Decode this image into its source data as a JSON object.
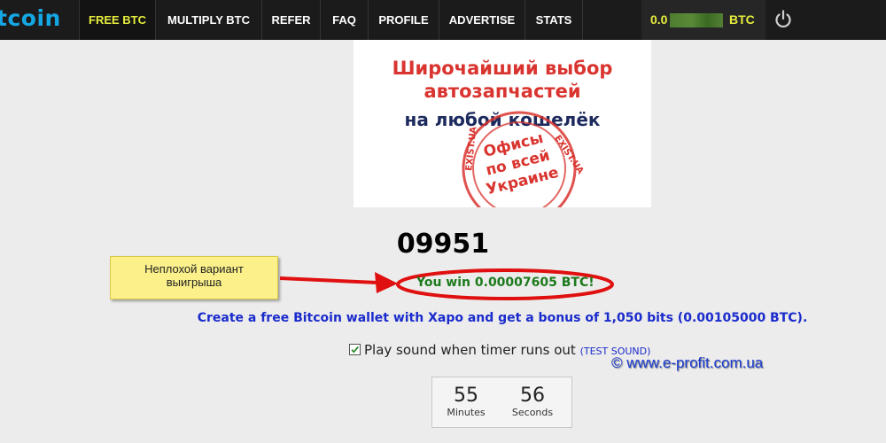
{
  "nav": {
    "logo": "tcoin",
    "items": [
      {
        "label": "FREE BTC",
        "active": true
      },
      {
        "label": "MULTIPLY BTC",
        "active": false
      },
      {
        "label": "REFER",
        "active": false
      },
      {
        "label": "FAQ",
        "active": false
      },
      {
        "label": "PROFILE",
        "active": false
      },
      {
        "label": "ADVERTISE",
        "active": false
      },
      {
        "label": "STATS",
        "active": false
      }
    ],
    "balance_prefix": "0.0",
    "balance_unit": "BTC",
    "power_icon": "power-icon"
  },
  "ad": {
    "line1": "Широчайший выбор",
    "line2": "автозапчастей",
    "line3": "на любой кошелёк",
    "stamp_lines": [
      "Офисы",
      "по всей",
      "Украине"
    ],
    "stamp_ring": "EXIST.UA"
  },
  "roll": {
    "number": "09951",
    "win_text": "You win 0.00007605 BTC!",
    "xapo_text": "Create a free Bitcoin wallet with Xapo and get a bonus of 1,050 bits (0.00105000 BTC)."
  },
  "sound": {
    "label": "Play sound when timer runs out",
    "checked": true,
    "test_label": "(TEST SOUND)"
  },
  "annotation": {
    "callout_line1": "Неплохой вариант",
    "callout_line2": "выигрыша",
    "watermark": "© www.e-profit.com.ua"
  },
  "timer": {
    "minutes": "55",
    "minutes_label": "Minutes",
    "seconds": "56",
    "seconds_label": "Seconds"
  },
  "colors": {
    "nav_bg": "#1b1b1b",
    "accent_yellow": "#e6ee3c",
    "logo_blue": "#15a7e4",
    "win_green": "#1c7a1c",
    "link_blue": "#1a2bcc",
    "annotation_red": "#e01010"
  }
}
